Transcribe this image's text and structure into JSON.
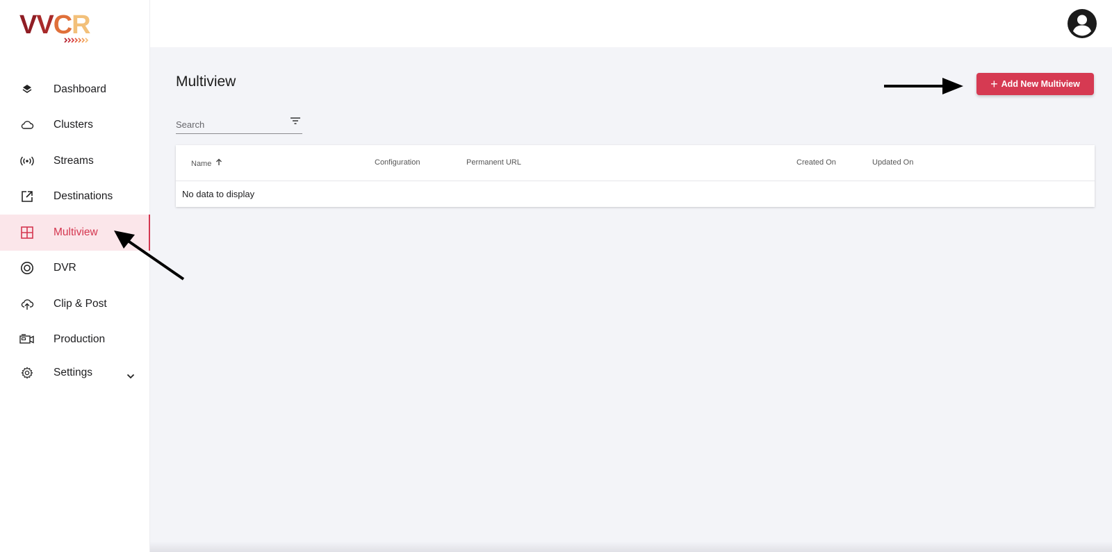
{
  "app": {
    "logo_text": "VVCR",
    "logo_parts": [
      "V",
      "V",
      "C",
      "R"
    ]
  },
  "sidebar": {
    "items": [
      {
        "label": "Dashboard",
        "icon": "layers-icon"
      },
      {
        "label": "Clusters",
        "icon": "cloud-icon"
      },
      {
        "label": "Streams",
        "icon": "broadcast-icon"
      },
      {
        "label": "Destinations",
        "icon": "external-link-icon"
      },
      {
        "label": "Multiview",
        "icon": "grid-icon",
        "active": true
      },
      {
        "label": "DVR",
        "icon": "record-icon"
      },
      {
        "label": "Clip & Post",
        "icon": "cloud-upload-icon"
      },
      {
        "label": "Production",
        "icon": "video-camera-icon"
      },
      {
        "label": "Settings",
        "icon": "gear-icon",
        "expandable": true
      }
    ]
  },
  "header": {
    "avatar_icon": "user-avatar-icon"
  },
  "main": {
    "title": "Multiview",
    "add_button_label": "Add New Multiview",
    "search_placeholder": "Search",
    "table": {
      "columns": [
        "Name",
        "Configuration",
        "Permanent URL",
        "Created On",
        "Updated On"
      ],
      "sort_column": "Name",
      "sort_direction": "ascending",
      "empty_message": "No data to display"
    }
  },
  "colors": {
    "accent": "#d63a52",
    "active_bg": "#fbe6ea",
    "page_bg": "#f3f4f8"
  }
}
